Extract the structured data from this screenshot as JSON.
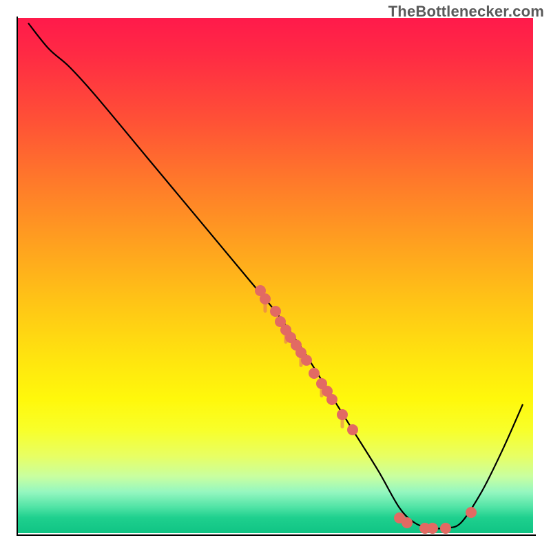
{
  "attribution": "TheBottleneсker.com",
  "chart_data": {
    "type": "line",
    "title": "",
    "xlabel": "",
    "ylabel": "",
    "xlim": [
      0,
      100
    ],
    "ylim": [
      0,
      100
    ],
    "background": "vertical-gradient red→yellow→green",
    "curve": {
      "description": "Bottleneck % curve, high at left dropping to near-zero valley around x≈80 then rising again",
      "points_xy": [
        [
          2,
          99
        ],
        [
          6,
          94
        ],
        [
          10,
          90.5
        ],
        [
          15,
          85
        ],
        [
          25,
          73
        ],
        [
          35,
          61
        ],
        [
          45,
          49
        ],
        [
          50,
          43
        ],
        [
          55,
          36
        ],
        [
          60,
          28
        ],
        [
          65,
          20
        ],
        [
          70,
          12
        ],
        [
          74,
          5
        ],
        [
          77,
          2
        ],
        [
          80,
          1
        ],
        [
          83,
          1
        ],
        [
          86,
          2
        ],
        [
          90,
          8
        ],
        [
          94,
          16
        ],
        [
          98,
          25
        ]
      ]
    },
    "markers": {
      "description": "Salmon circular data markers lying on the curve",
      "points_xy": [
        [
          47,
          47
        ],
        [
          48,
          45.5
        ],
        [
          50,
          43
        ],
        [
          51,
          41
        ],
        [
          52,
          39.5
        ],
        [
          53,
          38
        ],
        [
          54,
          36.5
        ],
        [
          55,
          35
        ],
        [
          56,
          33.5
        ],
        [
          57.5,
          31
        ],
        [
          59,
          29
        ],
        [
          60,
          27.5
        ],
        [
          61,
          26
        ],
        [
          63,
          23
        ],
        [
          65,
          20
        ],
        [
          74,
          3
        ],
        [
          75.5,
          2
        ],
        [
          79,
          1
        ],
        [
          80.5,
          1
        ],
        [
          83,
          1
        ],
        [
          88,
          4
        ]
      ],
      "color": "#e26a63"
    }
  }
}
